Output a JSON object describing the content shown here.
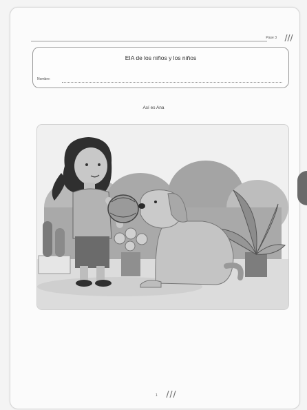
{
  "header": {
    "page_label": "Pase 3",
    "title": "EIA de los niños y los niños",
    "name_label": "Nombre:"
  },
  "caption": "Así es Ana",
  "illustration": {
    "description_icon": "girl-with-ball-and-dog-illustration"
  },
  "footer": {
    "page_number": "1"
  },
  "colors": {
    "frame": "#cfcfcf",
    "ink": "#3a3a3a",
    "tab": "#6a6a6a"
  }
}
